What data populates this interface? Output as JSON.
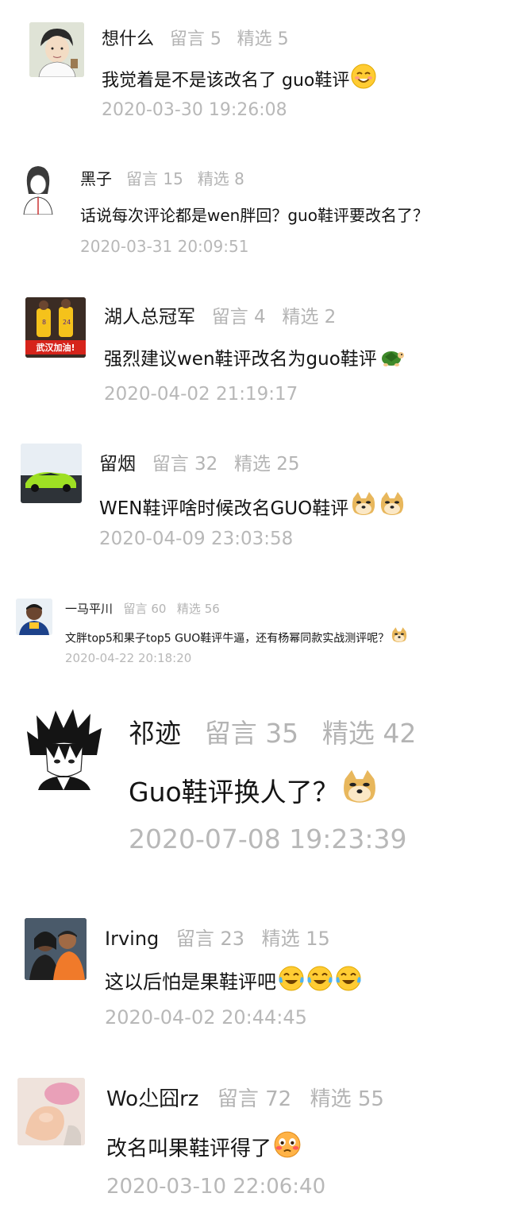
{
  "comments": [
    {
      "username": "想什么",
      "liuyan_label": "留言",
      "liuyan_count": "5",
      "jingxuan_label": "精选",
      "jingxuan_count": "5",
      "text": "我觉着是不是该改名了 guo鞋评",
      "timestamp": "2020-03-30 19:26:08",
      "avatar_icon": "cartoon-man-avatar",
      "emoji": [
        "blush-smile"
      ]
    },
    {
      "username": "黑子",
      "liuyan_label": "留言",
      "liuyan_count": "15",
      "jingxuan_label": "精选",
      "jingxuan_count": "8",
      "text": "话说每次评论都是wen胖回？guo鞋评要改名了？",
      "timestamp": "2020-03-31 20:09:51",
      "avatar_icon": "sketch-girl-avatar",
      "emoji": []
    },
    {
      "username": "湖人总冠军",
      "liuyan_label": "留言",
      "liuyan_count": "4",
      "jingxuan_label": "精选",
      "jingxuan_count": "2",
      "text": "强烈建议wen鞋评改名为guo鞋评",
      "timestamp": "2020-04-02 21:19:17",
      "avatar_icon": "lakers-players-avatar",
      "avatar_caption": "武汉加油!",
      "emoji": [
        "turtle"
      ]
    },
    {
      "username": "留烟",
      "liuyan_label": "留言",
      "liuyan_count": "32",
      "jingxuan_label": "精选",
      "jingxuan_count": "25",
      "text": "WEN鞋评啥时候改名GUO鞋评",
      "timestamp": "2020-04-09 23:03:58",
      "avatar_icon": "green-supercar-avatar",
      "emoji": [
        "doge",
        "doge"
      ]
    },
    {
      "username": "一马平川",
      "liuyan_label": "留言",
      "liuyan_count": "60",
      "jingxuan_label": "精选",
      "jingxuan_count": "56",
      "text": "文胖top5和果子top5  GUO鞋评牛逼，还有杨幂同款实战测评呢？",
      "timestamp": "2020-04-22 20:18:20",
      "avatar_icon": "basketball-player-avatar",
      "emoji": [
        "doge"
      ]
    },
    {
      "username": "祁迹",
      "liuyan_label": "留言",
      "liuyan_count": "35",
      "jingxuan_label": "精选",
      "jingxuan_count": "42",
      "text": "Guo鞋评换人了？",
      "timestamp": "2020-07-08 19:23:39",
      "avatar_icon": "anime-boy-avatar",
      "emoji": [
        "doge"
      ]
    },
    {
      "username": "Irving",
      "liuyan_label": "留言",
      "liuyan_count": "23",
      "jingxuan_label": "精选",
      "jingxuan_count": "15",
      "text": "这以后怕是果鞋评吧",
      "timestamp": "2020-04-02 20:44:45",
      "avatar_icon": "couple-photo-avatar",
      "emoji": [
        "tears-of-joy",
        "tears-of-joy",
        "tears-of-joy"
      ]
    },
    {
      "username": "Wo尐囧rz",
      "liuyan_label": "留言",
      "liuyan_count": "72",
      "jingxuan_label": "精选",
      "jingxuan_count": "55",
      "text": "改名叫果鞋评得了",
      "timestamp": "2020-03-10 22:06:40",
      "avatar_icon": "baby-hand-avatar",
      "emoji": [
        "flushed"
      ]
    }
  ],
  "colors": {
    "username": "#1a1a1a",
    "meta": "#b4b4b4",
    "body": "#141414",
    "time": "#b8b8b8"
  }
}
